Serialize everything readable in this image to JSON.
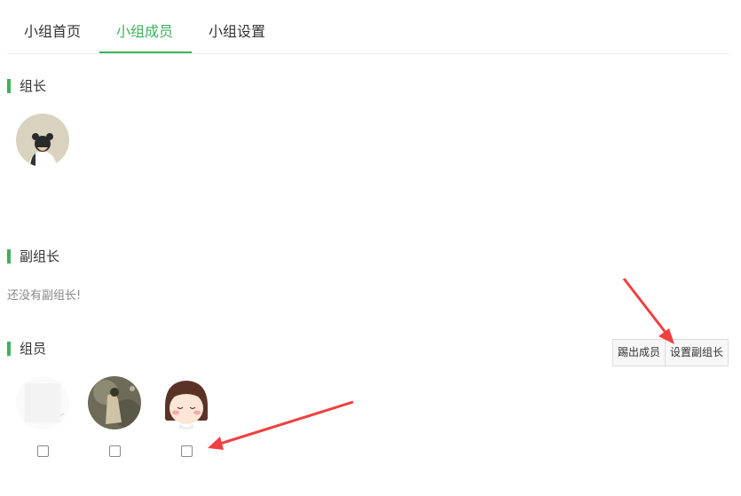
{
  "tabs": [
    {
      "label": "小组首页"
    },
    {
      "label": "小组成员"
    },
    {
      "label": "小组设置"
    }
  ],
  "sections": {
    "leader": {
      "title": "组长"
    },
    "deputy": {
      "title": "副组长",
      "empty_text": "还没有副组长!"
    },
    "members": {
      "title": "组员"
    }
  },
  "actions": {
    "kick_label": "踢出成员",
    "set_deputy_label": "设置副组长"
  },
  "colors": {
    "accent": "#3cb25b",
    "arrow": "#f04040"
  }
}
